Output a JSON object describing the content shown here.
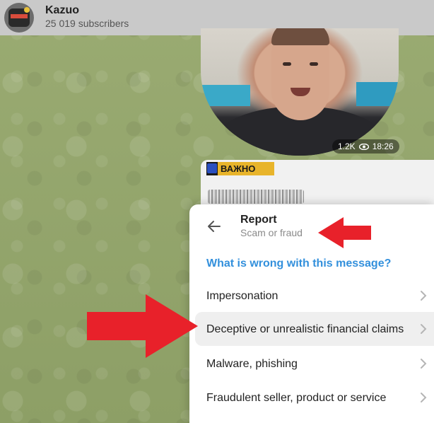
{
  "header": {
    "title": "Kazuo",
    "subscribers": "25 019 subscribers"
  },
  "video_message": {
    "views": "1.2K",
    "time": "18:26"
  },
  "message": {
    "tag": "ВАЖНО"
  },
  "report": {
    "title": "Report",
    "subtitle": "Scam or fraud",
    "question": "What is wrong with this message?",
    "options": [
      {
        "label": "Impersonation"
      },
      {
        "label": "Deceptive or unrealistic financial claims"
      },
      {
        "label": "Malware, phishing"
      },
      {
        "label": "Fraudulent seller, product or service"
      }
    ]
  },
  "icons": {
    "back": "arrow-left-icon",
    "chevron": "chevron-right-icon",
    "views": "eye-icon"
  },
  "colors": {
    "accent": "#3390dc",
    "annotation_arrow": "#e8212a",
    "highlight": "#efefef"
  }
}
